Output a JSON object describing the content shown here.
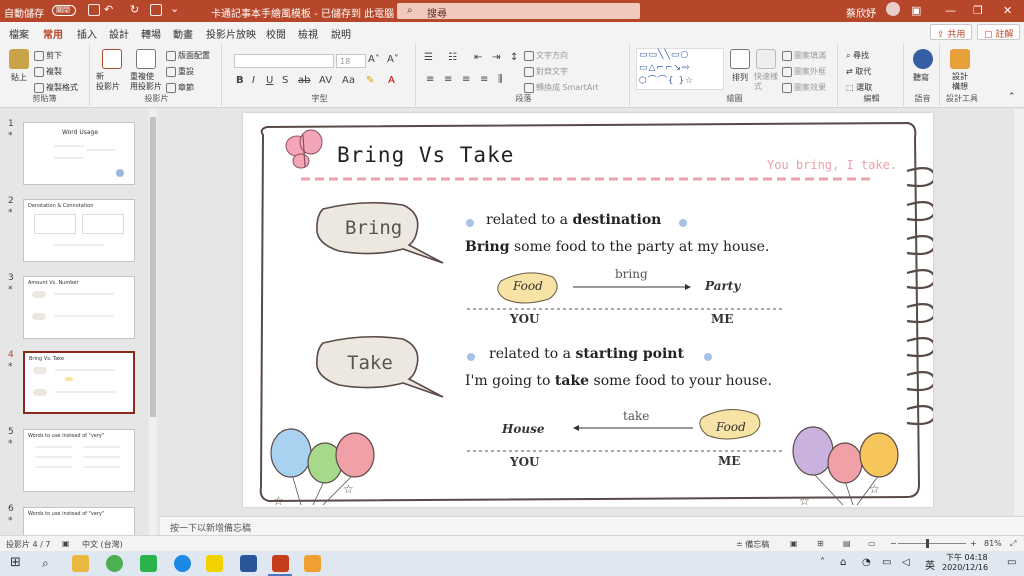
{
  "titlebar": {
    "autosave": "自動儲存",
    "toggle": "關閉",
    "doc_title": "卡通記事本手繪風模板 - 已儲存到 此電腦",
    "search_placeholder": "搜尋",
    "user": "蔡欣妤"
  },
  "tabs": [
    "檔案",
    "常用",
    "插入",
    "設計",
    "轉場",
    "動畫",
    "投影片放映",
    "校閱",
    "檢視",
    "說明"
  ],
  "share": {
    "share_label": "共用",
    "comment_label": "註解"
  },
  "ribbon": {
    "clipboard": {
      "paste": "貼上",
      "cut": "剪下",
      "copy": "複製",
      "format_painter": "複製格式",
      "label": "剪貼簿"
    },
    "slides": {
      "new_slide": "新\n投影片",
      "reuse": "重複使\n用投影片",
      "layout": "版面配置",
      "reset": "重設",
      "section": "章節",
      "label": "投影片"
    },
    "font": {
      "label": "字型",
      "size": "18"
    },
    "paragraph": {
      "label": "段落",
      "text_direction": "文字方向",
      "align_text": "對齊文字",
      "smartart": "轉換成 SmartArt"
    },
    "drawing": {
      "label": "繪圖",
      "arrange": "排列",
      "quick_styles": "快速樣\n式",
      "fill": "圖案填滿",
      "outline": "圖案外框",
      "effects": "圖案效果"
    },
    "editing": {
      "label": "編輯",
      "find": "尋找",
      "replace": "取代",
      "select": "選取"
    },
    "voice": {
      "label": "語音",
      "dictate": "聽寫"
    },
    "designer": {
      "label": "設計工具",
      "design_ideas": "設計\n構想"
    }
  },
  "thumbnails": [
    {
      "num": "1",
      "title": "Word Usage"
    },
    {
      "num": "2",
      "title": "Denotation & Connotation"
    },
    {
      "num": "3",
      "title": "Amount Vs. Number"
    },
    {
      "num": "4",
      "title": "Bring Vs. Take"
    },
    {
      "num": "5",
      "title": "Words to use instead of \"very\""
    },
    {
      "num": "6",
      "title": "Words to use instead of \"very\""
    }
  ],
  "slide": {
    "title": "Bring Vs Take",
    "subtitle": "You bring, I take.",
    "bring_bubble": "Bring",
    "bring_point_prefix": "related to a ",
    "bring_point_bold": "destination",
    "bring_sentence_bold": "Bring",
    "bring_sentence_rest": " some food to the party at my house.",
    "bring_food": "Food",
    "bring_arrow_label": "bring",
    "bring_party": "Party",
    "bring_you": "YOU",
    "bring_me": "ME",
    "take_bubble": "Take",
    "take_point_prefix": "related to a ",
    "take_point_bold": "starting point",
    "take_sentence_prefix": "I'm going to ",
    "take_sentence_bold": "take",
    "take_sentence_rest": " some food to your house.",
    "take_house": "House",
    "take_arrow_label": "take",
    "take_food": "Food",
    "take_you": "YOU",
    "take_me": "ME"
  },
  "notes_placeholder": "按一下以新增備忘稿",
  "status": {
    "slide_count": "投影片 4 / 7",
    "language": "中文 (台灣)",
    "notes": "備忘稿",
    "zoom": "81%"
  },
  "taskbar": {
    "time": "下午 04:18",
    "date": "2020/12/16",
    "ime": "英"
  },
  "colors": {
    "accent": "#b7472a",
    "bubble_fill": "#ede8df",
    "food_fill": "#f7e3a6",
    "dash_pink": "#e8a3ab",
    "bullet_blue": "#a9c3e6"
  }
}
